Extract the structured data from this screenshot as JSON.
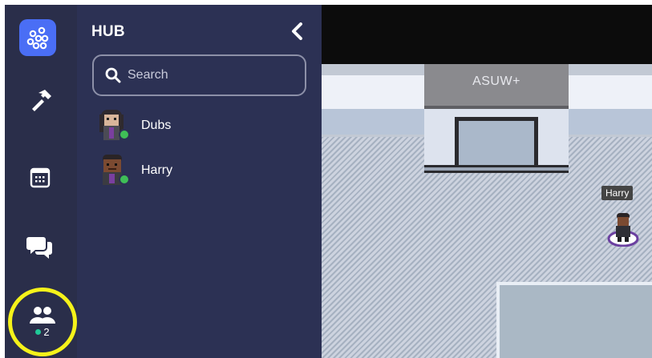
{
  "sidebar": {
    "icons": [
      "hub-logo-icon",
      "hammer-icon",
      "calendar-icon",
      "chat-icon",
      "people-icon"
    ],
    "online_count": "2",
    "accent_color": "#4a6ef5",
    "highlight_color": "#f5f21a"
  },
  "panel": {
    "title": "HUB",
    "search_placeholder": "Search",
    "users": [
      {
        "name": "Dubs",
        "status": "online"
      },
      {
        "name": "Harry",
        "status": "online"
      }
    ]
  },
  "game": {
    "sign": "ASUW+",
    "player_tag": "Harry"
  },
  "colors": {
    "rail": "#2a2e4a",
    "panel": "#2c3154",
    "online": "#3fbf57"
  }
}
